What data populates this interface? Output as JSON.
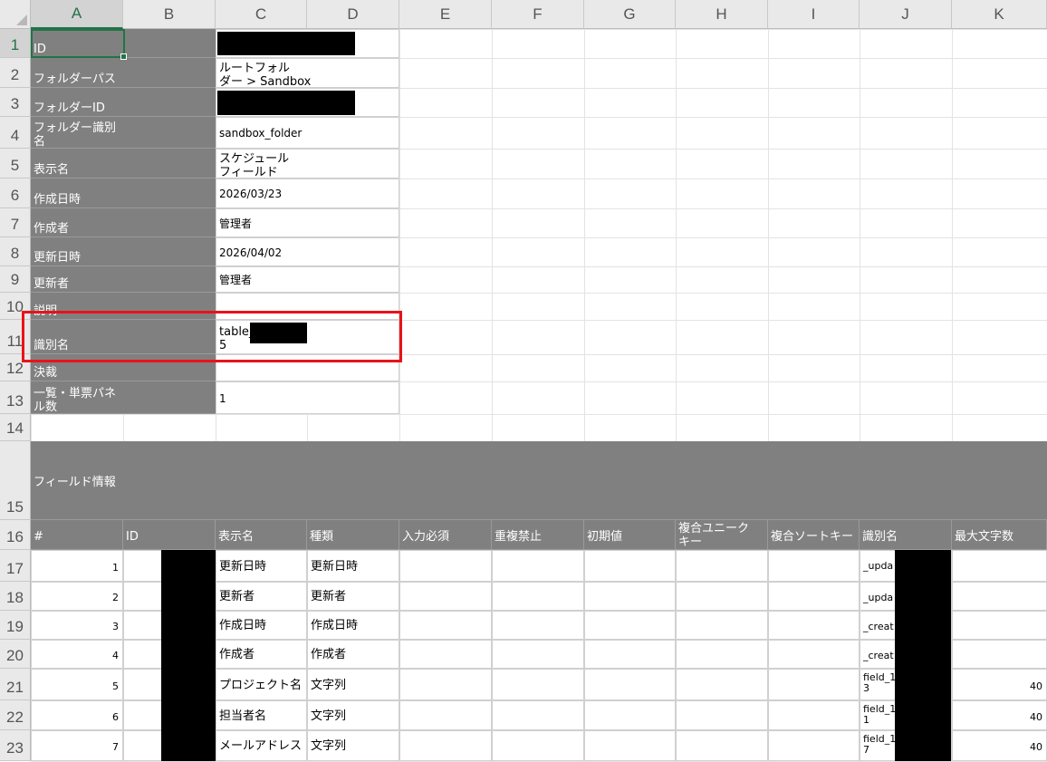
{
  "columns": [
    "A",
    "B",
    "C",
    "D",
    "E",
    "F",
    "G",
    "H",
    "I",
    "J",
    "K"
  ],
  "rows": [
    "1",
    "2",
    "3",
    "4",
    "5",
    "6",
    "7",
    "8",
    "9",
    "10",
    "11",
    "12",
    "13",
    "14",
    "15",
    "16",
    "17",
    "18",
    "19",
    "20",
    "21",
    "22",
    "23"
  ],
  "meta": [
    {
      "label": "ID",
      "value": ""
    },
    {
      "label": "フォルダーパス",
      "value": "ルートフォル\nダー > Sandbox"
    },
    {
      "label": "フォルダーID",
      "value": ""
    },
    {
      "label": "フォルダー識別\n名",
      "value": "sandbox_folder"
    },
    {
      "label": "表示名",
      "value": "スケジュール\nフィールド"
    },
    {
      "label": "作成日時",
      "value": "2026/03/23"
    },
    {
      "label": "作成者",
      "value": "管理者"
    },
    {
      "label": "更新日時",
      "value": "2026/04/02"
    },
    {
      "label": "更新者",
      "value": "管理者"
    },
    {
      "label": "説明",
      "value": ""
    },
    {
      "label": "識別名",
      "value": "table_\n5"
    },
    {
      "label": "決裁",
      "value": ""
    },
    {
      "label": "一覧・単票パネ\nル数",
      "value": "1"
    }
  ],
  "section_title": "フィールド情報",
  "field_headers": [
    "#",
    "ID",
    "表示名",
    "種類",
    "入力必須",
    "重複禁止",
    "初期値",
    "複合ユニーク\nキー",
    "複合ソートキー",
    "識別名",
    "最大文字数"
  ],
  "field_rows": [
    {
      "num": "1",
      "name": "更新日時",
      "type": "更新日時",
      "ident": "_upda",
      "maxlen": ""
    },
    {
      "num": "2",
      "name": "更新者",
      "type": "更新者",
      "ident": "_upda",
      "maxlen": ""
    },
    {
      "num": "3",
      "name": "作成日時",
      "type": "作成日時",
      "ident": "_creat",
      "maxlen": ""
    },
    {
      "num": "4",
      "name": "作成者",
      "type": "作成者",
      "ident": "_creat",
      "maxlen": ""
    },
    {
      "num": "5",
      "name": "プロジェクト名",
      "type": "文字列",
      "ident": "field_1\n3",
      "maxlen": "40"
    },
    {
      "num": "6",
      "name": "担当者名",
      "type": "文字列",
      "ident": "field_1\n1",
      "maxlen": "40"
    },
    {
      "num": "7",
      "name": "メールアドレス",
      "type": "文字列",
      "ident": "field_1\n7",
      "maxlen": "40"
    }
  ],
  "colors": {
    "header_gray": "#808080",
    "highlight": "#e8131a",
    "excel_green": "#217346"
  }
}
